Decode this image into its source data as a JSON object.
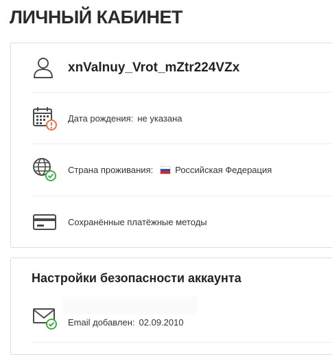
{
  "page": {
    "title": "ЛИЧНЫЙ КАБИНЕТ"
  },
  "profile": {
    "username": "xnValnuy_Vrot_mZtr224VZx",
    "birthdate": {
      "label": "Дата рождения:",
      "value": "не указана"
    },
    "country": {
      "label": "Страна проживания:",
      "value": "Российская Федерация"
    },
    "payment_methods": {
      "label": "Сохранённые платёжные методы"
    }
  },
  "security": {
    "title": "Настройки безопасности аккаунта",
    "email": {
      "label": "Email добавлен:",
      "value": "02.09.2010"
    }
  },
  "colors": {
    "warning": "#e8704a",
    "success": "#3fae4a",
    "icon": "#4a4a4a",
    "border": "#d3e0ea"
  },
  "icons": [
    "user-icon",
    "calendar-icon",
    "globe-icon",
    "credit-card-icon",
    "envelope-icon"
  ]
}
